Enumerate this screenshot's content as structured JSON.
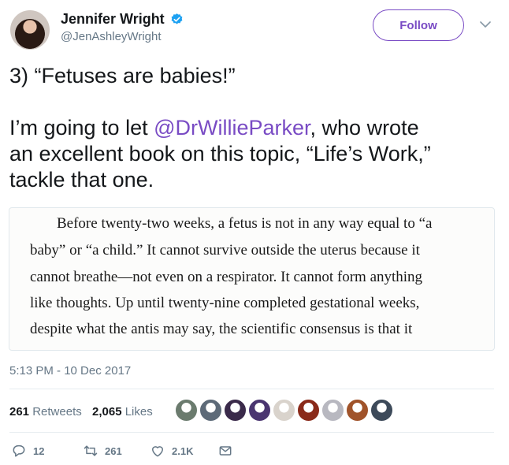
{
  "author": {
    "name": "Jennifer Wright",
    "handle": "@JenAshleyWright",
    "verified": true
  },
  "follow_label": "Follow",
  "tweet": {
    "line1": "3) “Fetuses are babies!”",
    "line2_before": "I’m going to let ",
    "mention": "@DrWillieParker",
    "line2_after": ", who wrote",
    "line3": "an excellent book on this topic, “Life’s Work,”",
    "line4": "tackle that one."
  },
  "media": {
    "lines": [
      "Before twenty-two weeks, a fetus is not in any way equal to “a",
      "baby” or “a child.” It cannot survive outside the uterus because it",
      "cannot breathe—not even on a respirator. It cannot form anything",
      "like thoughts. Up until twenty-nine completed gestational weeks,",
      "despite what the antis may say, the scientific consensus is that it"
    ]
  },
  "timestamp": "5:13 PM - 10 Dec 2017",
  "stats": {
    "retweets_count": "261",
    "retweets_label": "Retweets",
    "likes_count": "2,065",
    "likes_label": "Likes"
  },
  "liker_colors": [
    "#6b7b6e",
    "#5d6a78",
    "#3a2a4a",
    "#4a3570",
    "#d9d3cc",
    "#8a2a1a",
    "#b8b8c0",
    "#a0532a",
    "#3d4a5a"
  ],
  "actions": {
    "reply_count": "12",
    "retweet_count": "261",
    "like_count": "2.1K"
  },
  "colors": {
    "accent": "#794bc4",
    "verified": "#1da1f2",
    "muted": "#657786"
  }
}
